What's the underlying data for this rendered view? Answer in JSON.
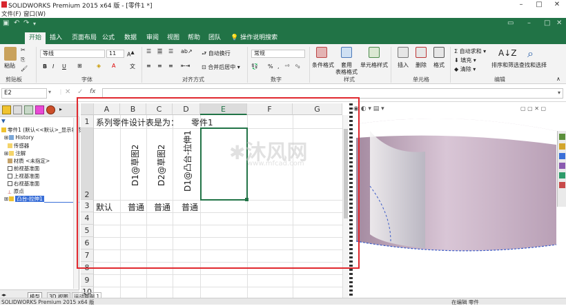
{
  "app": {
    "title": "SOLIDWORKS Premium 2015 x64 版 - [零件1 *]",
    "menu": [
      "文件(F)",
      "窗口(W)"
    ]
  },
  "ribbon": {
    "tabs": [
      "开始",
      "插入",
      "页面布局",
      "公式",
      "数据",
      "审阅",
      "视图",
      "帮助",
      "团队",
      "操作说明搜索"
    ],
    "active_tab": "开始",
    "groups": {
      "clipboard": {
        "label": "剪贴板",
        "paste": "粘贴"
      },
      "font": {
        "label": "字体",
        "font_name": "等线",
        "font_size": "11",
        "bold": "B",
        "italic": "I",
        "underline": "U"
      },
      "alignment": {
        "label": "对齐方式",
        "wrap": "自动换行",
        "merge": "合并后居中"
      },
      "number": {
        "label": "数字",
        "format": "常规",
        "percent": "%"
      },
      "styles": {
        "label": "样式",
        "conditional": "条件格式",
        "table_format_1": "套用",
        "table_format_2": "表格格式",
        "cell_style": "单元格样式"
      },
      "cells": {
        "label": "单元格",
        "insert": "插入",
        "delete": "删除",
        "format": "格式"
      },
      "editing": {
        "label": "编辑",
        "autosum": "自动求和",
        "fill": "填充",
        "clear": "清除",
        "sort": "排序和筛选",
        "find": "查找和选择"
      }
    }
  },
  "formula_bar": {
    "name_box": "E2",
    "fx": "fx",
    "value": ""
  },
  "tree": {
    "root": "零件1  (默认<<默认>_显示状态",
    "items": [
      "History",
      "传感器",
      "注解",
      "材质 <未指定>",
      "前视基准面",
      "上视基准面",
      "右视基准面",
      "原点",
      "凸台-拉伸1"
    ]
  },
  "sheet": {
    "columns": [
      "A",
      "B",
      "C",
      "D",
      "E",
      "F",
      "G"
    ],
    "rows": [
      "1",
      "2",
      "3",
      "4",
      "5",
      "6",
      "7",
      "8",
      "9",
      "10"
    ],
    "a1": "系列零件设计表是为：",
    "d1": "零件1",
    "row2_headers": [
      "D1@草图2",
      "D2@草图2",
      "D1@凸台-拉伸1"
    ],
    "row3": [
      "默认",
      "普通",
      "普通",
      "普通"
    ]
  },
  "bottom_tabs": [
    "模型",
    "3D 视图",
    "运动算例 1"
  ],
  "status": {
    "left": "SOLIDWORKS Premium 2015 x64 版",
    "right": "在编辑 零件"
  },
  "watermark": {
    "text": "沐风网",
    "url": "www.mfcad.com"
  },
  "colors": {
    "accent": "#217346",
    "highlight_box": "#e0272d",
    "selection": "#3a6fd8"
  }
}
